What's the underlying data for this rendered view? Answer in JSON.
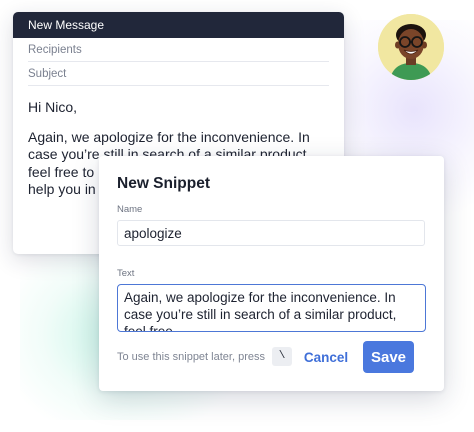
{
  "message": {
    "title": "New Message",
    "recipients_label": "Recipients",
    "subject_label": "Subject",
    "greeting": "Hi Nico,",
    "body_line_1": "Again, we apologize for the inconvenience. In",
    "body_line_2": "case you’re still in search of a similar product,",
    "body_line_3": "feel free to",
    "body_line_4": "help you in"
  },
  "snippet": {
    "title": "New Snippet",
    "name_label": "Name",
    "name_value": "apologize",
    "text_label": "Text",
    "text_value": "Again, we apologize for the inconvenience. In case you’re still in search of a similar product, feel free…",
    "hint": "To use this snippet later, press",
    "shortcut_key": "\\",
    "cancel_label": "Cancel",
    "save_label": "Save"
  },
  "colors": {
    "header_bg": "#21273a",
    "accent": "#4a78de",
    "avatar_bg": "#f1e7a1"
  }
}
